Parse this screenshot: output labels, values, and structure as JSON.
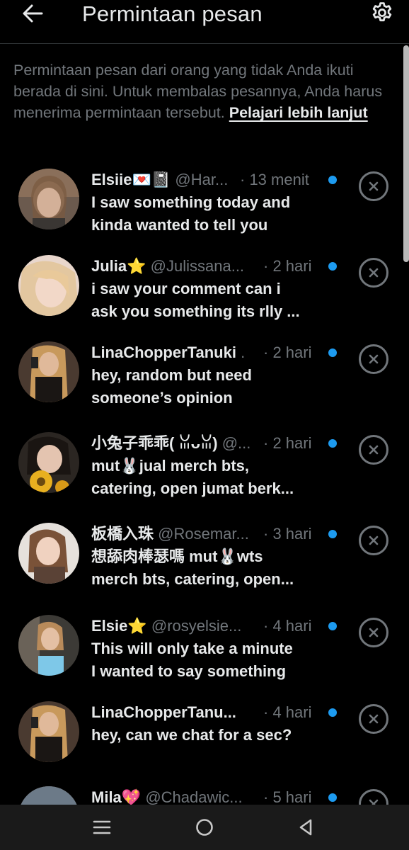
{
  "header": {
    "title": "Permintaan pesan",
    "back_icon": "arrow-left-icon",
    "settings_icon": "gear-icon"
  },
  "info": {
    "text": "Permintaan pesan dari orang yang tidak Anda ikuti berada di sini. Untuk membalas pesannya, Anda harus menerima permintaan tersebut.",
    "link": "Pelajari lebih lanjut"
  },
  "requests": [
    {
      "name": "Elsiie💌📓",
      "handle": "@Har...",
      "time": "· 13 menit",
      "line1": "I saw something today and",
      "line2": "kinda wanted to tell you"
    },
    {
      "name": "Julia⭐",
      "handle": "@Julissana...",
      "time": "· 2 hari",
      "line1": "i saw your comment can i",
      "line2": "ask you something its rlly ..."
    },
    {
      "name": "LinaChopperTanuki",
      "handle": ".",
      "time": "· 2 hari",
      "line1": "hey, random but need",
      "line2": "someone’s opinion"
    },
    {
      "name": "小兔子乖乖( ꈍᴗꈍ)",
      "handle": "@...",
      "time": "· 2 hari",
      "line1": "mut🐰jual merch bts,",
      "line2": "catering, open jumat berk..."
    },
    {
      "name": "板橋入珠",
      "handle": "@Rosemar...",
      "time": "· 3 hari",
      "line1": "想舔肉棒瑟嗎 mut🐰wts",
      "line2": "merch bts, catering, open..."
    },
    {
      "name": "Elsie⭐",
      "handle": "@rosyelsie...",
      "time": "· 4 hari",
      "line1": "This will only take a minute",
      "line2": "I wanted to say something"
    },
    {
      "name": "LinaChopperTanu...",
      "handle": "",
      "time": "· 4 hari",
      "line1": "hey, can we chat for a sec?",
      "line2": ""
    },
    {
      "name": "Mila💖",
      "handle": "@Chadawic...",
      "time": "· 5 hari",
      "line1": "",
      "line2": ""
    }
  ],
  "icons": {
    "close": "close-circle-icon",
    "unread": "unread-dot-icon",
    "nav_recent": "recent-apps-icon",
    "nav_home": "home-circle-icon",
    "nav_back": "back-triangle-icon"
  },
  "colors": {
    "background": "#000000",
    "text": "#e7e9ea",
    "muted": "#71767b",
    "accent": "#1d9bf0"
  }
}
